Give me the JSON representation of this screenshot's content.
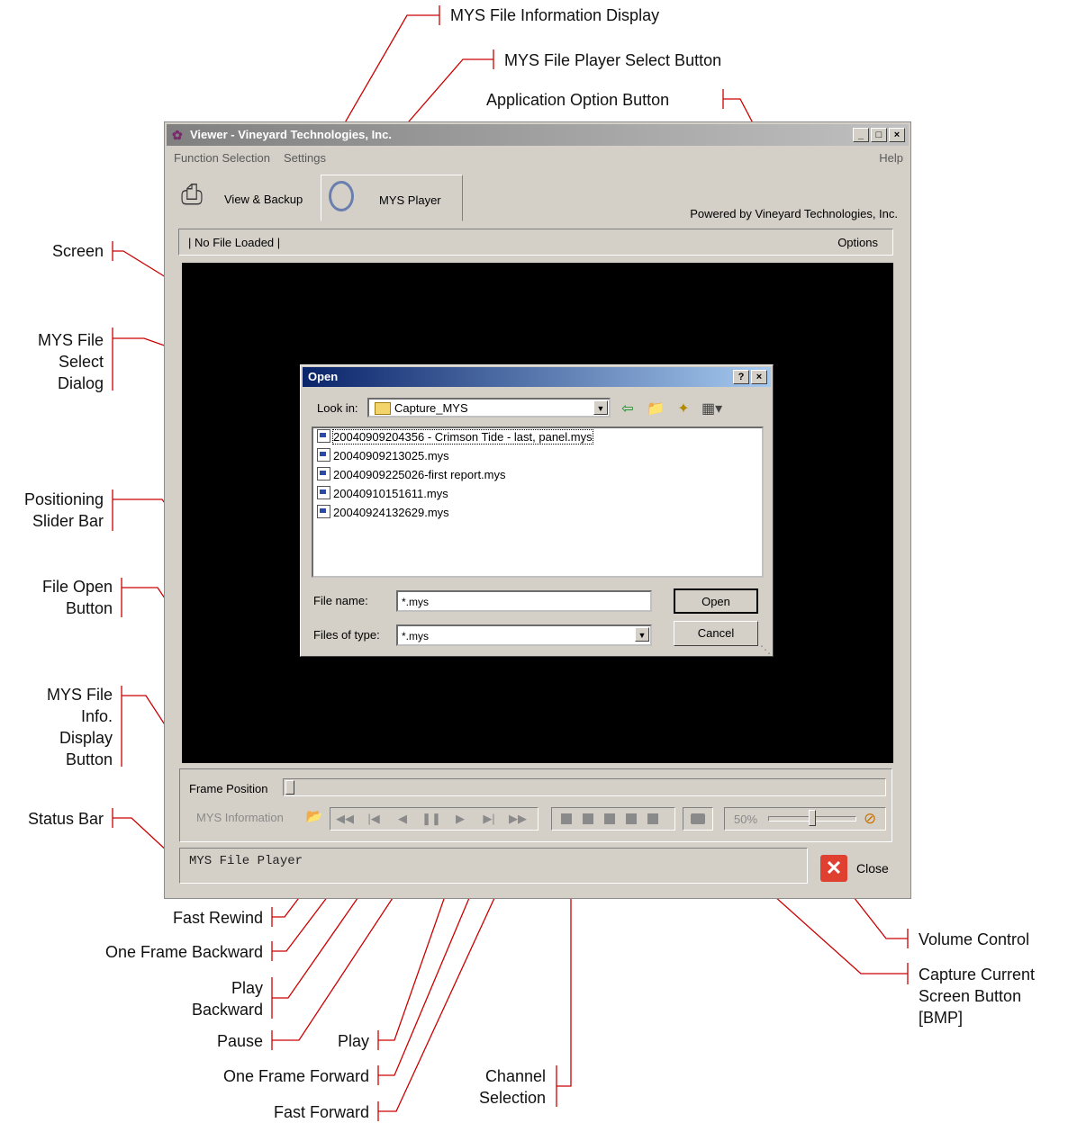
{
  "annotations": {
    "left": [
      {
        "id": "screen",
        "text": "Screen"
      },
      {
        "id": "dialog",
        "text": "MYS File Select Dialog",
        "lines": [
          "MYS File",
          "Select",
          "Dialog"
        ]
      },
      {
        "id": "slider",
        "text": "Positioning Slider Bar",
        "lines": [
          "Positioning",
          "Slider Bar"
        ]
      },
      {
        "id": "fileopen",
        "text": "File Open Button",
        "lines": [
          "File Open",
          "Button"
        ]
      },
      {
        "id": "infobtn",
        "text": "MYS File Info. Display Button",
        "lines": [
          "MYS File",
          "Info.",
          "Display",
          "Button"
        ]
      },
      {
        "id": "status",
        "text": "Status Bar"
      }
    ],
    "top": [
      {
        "id": "info-display",
        "text": "MYS File Information Display"
      },
      {
        "id": "player-select",
        "text": "MYS File Player Select Button"
      },
      {
        "id": "app-option",
        "text": "Application Option Button"
      }
    ],
    "bottom": [
      {
        "id": "fast-rewind",
        "text": "Fast Rewind"
      },
      {
        "id": "one-frame-back",
        "text": "One Frame Backward"
      },
      {
        "id": "play-back",
        "text": "Play Backward",
        "lines": [
          "Play",
          "Backward"
        ]
      },
      {
        "id": "pause",
        "text": "Pause"
      },
      {
        "id": "play",
        "text": "Play"
      },
      {
        "id": "one-frame-fwd",
        "text": "One Frame Forward"
      },
      {
        "id": "fast-fwd",
        "text": "Fast Forward"
      },
      {
        "id": "channel",
        "text": "Channel Selection",
        "lines": [
          "Channel",
          "Selection"
        ]
      },
      {
        "id": "volume",
        "text": "Volume Control"
      },
      {
        "id": "capture",
        "text": "Capture Current Screen Button [BMP]",
        "lines": [
          "Capture Current",
          "Screen Button",
          "[BMP]"
        ]
      }
    ]
  },
  "window": {
    "title": "Viewer - Vineyard Technologies, Inc.",
    "controls": [
      "_",
      "□",
      "×"
    ],
    "menu": [
      "Function Selection",
      "Settings"
    ],
    "menu_help": "Help",
    "tabs": [
      {
        "label": "View & Backup",
        "icon": "printer-icon"
      },
      {
        "label": "MYS Player",
        "icon": "disc-icon",
        "selected": true
      }
    ],
    "powered": "Powered by Vineyard Technologies, Inc.",
    "info_text": "| No File Loaded |",
    "options_label": "Options",
    "frame_position_label": "Frame Position",
    "frame_position": 0,
    "mys_info_label": "MYS Information",
    "volume_label": "50%",
    "volume": 0.5,
    "status_text": "MYS File Player",
    "close_label": "Close"
  },
  "dialog": {
    "title": "Open",
    "help_button": "?",
    "close_button": "×",
    "look_in_label": "Look in:",
    "look_in_value": "Capture_MYS",
    "files": [
      "20040909204356 - Crimson Tide - last, panel.mys",
      "20040909213025.mys",
      "20040909225026-first report.mys",
      "20040910151611.mys",
      "20040924132629.mys"
    ],
    "file_name_label": "File name:",
    "file_name_value": "*.mys",
    "file_type_label": "Files of type:",
    "file_type_value": "*.mys",
    "open_button": "Open",
    "cancel_button": "Cancel"
  },
  "colors": {
    "annotation_line": "#cc0000",
    "screen": "#000000"
  }
}
